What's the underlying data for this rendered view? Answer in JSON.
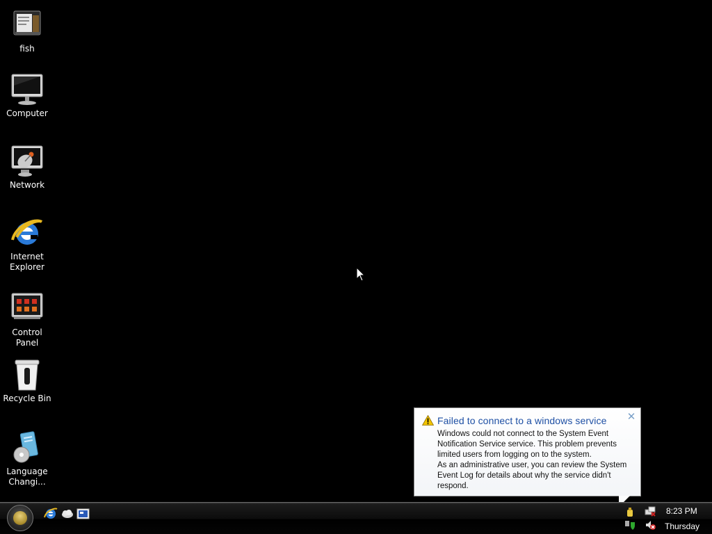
{
  "desktop_icons": [
    {
      "label": "fish",
      "icon": "document-folder-icon"
    },
    {
      "label": "Computer",
      "icon": "computer-monitor-icon"
    },
    {
      "label": "Network",
      "icon": "network-satellite-icon"
    },
    {
      "label": "Internet Explorer",
      "icon": "internet-explorer-icon"
    },
    {
      "label": "Control Panel",
      "icon": "control-panel-icon"
    },
    {
      "label": "Recycle Bin",
      "icon": "recycle-bin-icon"
    },
    {
      "label": "Language Changi...",
      "icon": "language-changer-icon"
    }
  ],
  "notification": {
    "title": "Failed to connect to a windows service",
    "body_line1": "Windows could not connect to the System Event Notification Service service. This problem prevents limited users from logging on to the system.",
    "body_line2": "As an administrative user, you can review the System Event Log for details about why the service didn't respond.",
    "icon": "warning-icon",
    "close_icon": "close-icon"
  },
  "taskbar": {
    "start_icon": "start-orb-icon",
    "quick_launch": [
      "internet-explorer-icon",
      "cloud-icon",
      "show-desktop-icon"
    ],
    "tray_icons": [
      "network-icon",
      "volume-muted-icon",
      "security-warning-icon",
      "shield-icon"
    ],
    "clock": {
      "time": "8:23 PM",
      "day": "Thursday"
    }
  },
  "colors": {
    "desktop_background": "#000000",
    "balloon_title": "#1d4fa4",
    "warning": "#f2c500"
  }
}
